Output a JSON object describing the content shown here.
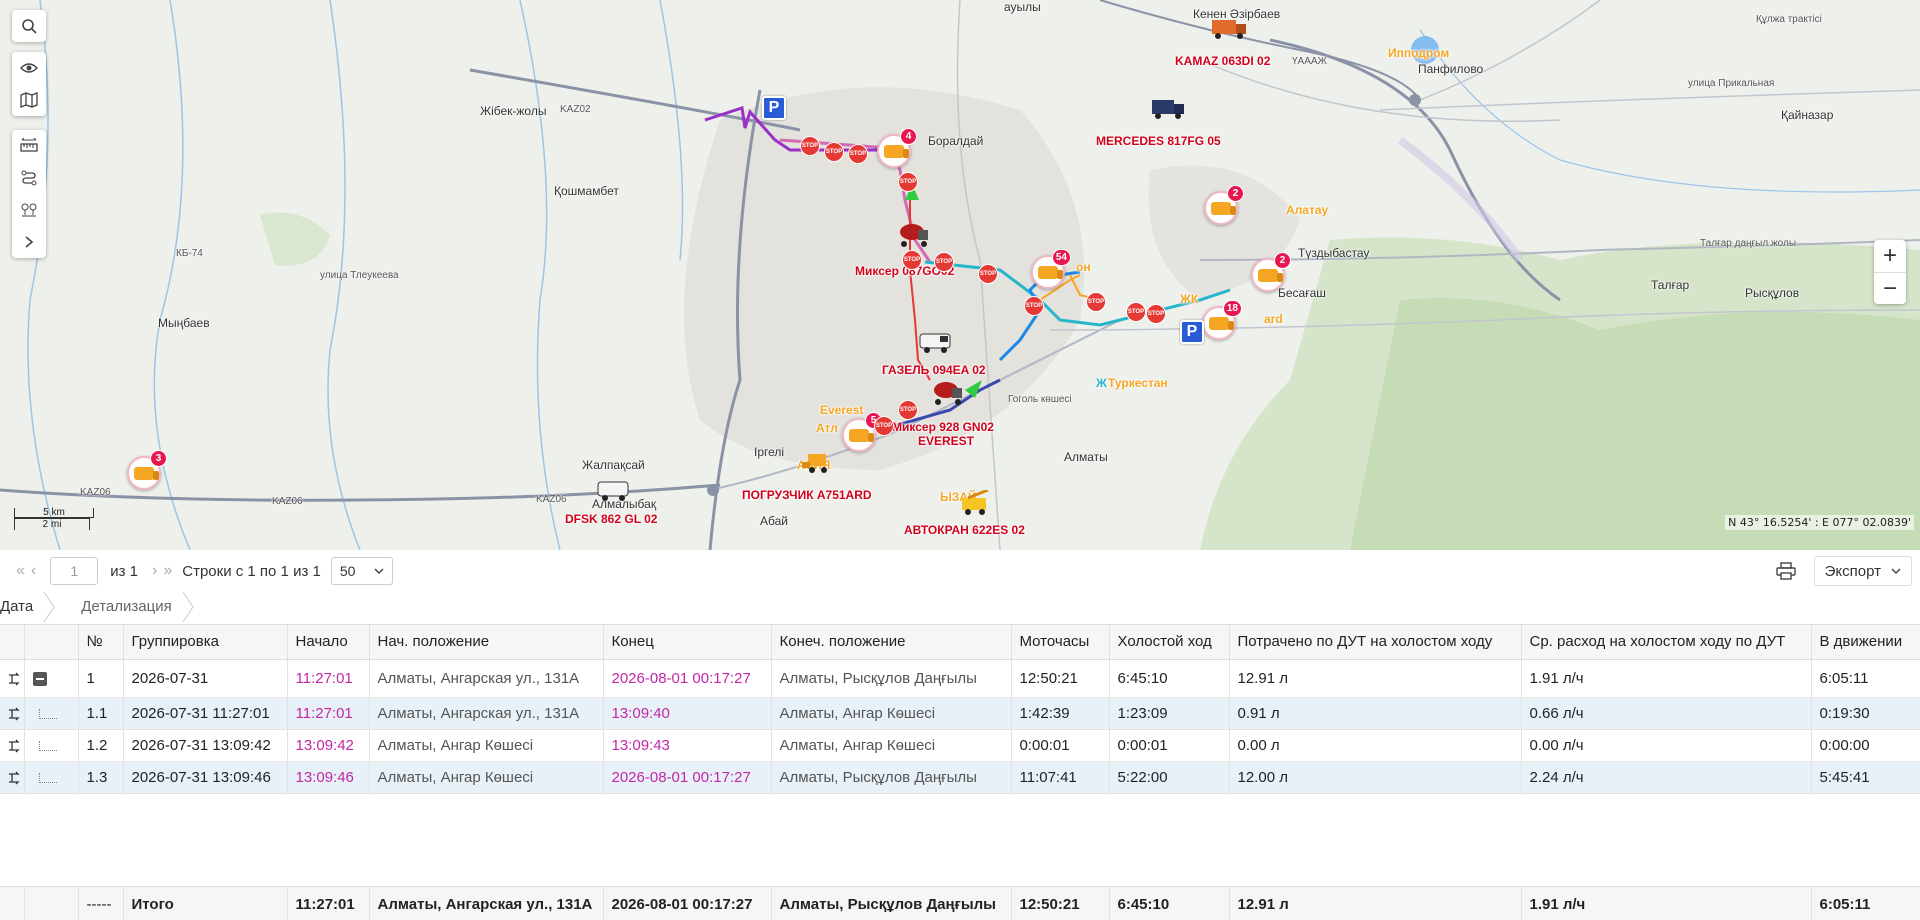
{
  "map": {
    "vehicles": [
      {
        "id": "kamaz",
        "label": "KAMAZ 063DI 02",
        "color": "red"
      },
      {
        "id": "mercedes",
        "label": "MERCEDES 817FG 05",
        "color": "red"
      },
      {
        "id": "mixer087",
        "label": "Миксер 087GO02",
        "color": "red"
      },
      {
        "id": "gazel",
        "label": "ГАЗЕЛЬ 094EA 02",
        "color": "red"
      },
      {
        "id": "mixer928",
        "label": "Миксер 928 GN02",
        "color": "red"
      },
      {
        "id": "everest",
        "label": "EVEREST",
        "color": "red"
      },
      {
        "id": "loader",
        "label": "ПОГРУЗЧИК A751ARD",
        "color": "red"
      },
      {
        "id": "dfsk",
        "label": "DFSK 862 GL 02",
        "color": "red"
      },
      {
        "id": "crane",
        "label": "АВТОКРАН 622ES 02",
        "color": "red"
      }
    ],
    "zone_labels": {
      "alatau": "Алатау",
      "hippodrome": "Ипподром",
      "turkestan": "Туркестан",
      "everest_zone": "Everest",
      "atl": "Атл",
      "asia": "АЗИЯ",
      "bayzak": "ЫЗАЙ",
      "on": "он",
      "zhk": "ЖК",
      "boulevard": "ard",
      "turk_zh": "Ж"
    },
    "places": {
      "aulyl": "ауылы",
      "kenen": "Кенен Әзірбаев",
      "zhibek": "Жібек-жолы",
      "boraldai": "Боралдай",
      "koshmambet": "Қошмамбет",
      "panfilovo": "Панфилово",
      "kainazar": "Қайназар",
      "tuzdybastau": "Түздыбастау",
      "besagash": "Бесағаш",
      "talgar": "Талғар",
      "ryskulov": "Рысқұлов",
      "myngaev": "Мыңбаев",
      "zhalpaksai": "Жалпақсай",
      "almalybak": "Алмалыбақ",
      "irgeli": "Іргелі",
      "abai": "Абай",
      "almaty": "Алматы",
      "goghol": "Гоголь көшесі",
      "tleukeev": "улица Тлеукеева",
      "kaz06a": "KAZ06",
      "kaz06b": "KAZ06",
      "kaz06c": "KAZ06",
      "kaz02": "KAZ02",
      "kb74": "КБ-74",
      "talgar_trakt": "Талғар даңғыл жолы",
      "kulzha_trakt": "Құлжа трактісі",
      "prikal": "улица Прикальная",
      "uaaazh": "ҮАААЖ"
    },
    "badges": {
      "m1": "4",
      "m2": "54",
      "m3": "2",
      "m4": "2",
      "m5": "18",
      "m6": "5",
      "m7": "3"
    },
    "stop_text": "STOP",
    "parking_text": "P",
    "scale_km": "5 km",
    "scale_mi": "2 mi",
    "coords": "N 43° 16.5254' : E 077° 02.0839'",
    "zoom_in": "+",
    "zoom_out": "−"
  },
  "pager": {
    "page": "1",
    "of_pages": "из 1",
    "rows_info": "Строки с 1 по 1 из 1",
    "per_page": "50",
    "export": "Экспорт"
  },
  "breadcrumb": [
    "Дата",
    "Детализация"
  ],
  "table": {
    "columns": [
      "№",
      "Группировка",
      "Начало",
      "Нач. положение",
      "Конец",
      "Конеч. положение",
      "Моточасы",
      "Холостой ход",
      "Потрачено по ДУТ на холостом ходу",
      "Ср. расход на холостом ходу по ДУТ",
      "В движении"
    ],
    "rows": [
      {
        "num": "1",
        "group": "2026-07-31",
        "start": "11:27:01",
        "start_pos": "Алматы, Ангарская ул., 131А",
        "end": "2026-08-01 00:17:27",
        "end_pos": "Алматы, Рысқұлов Даңғылы",
        "moto": "12:50:21",
        "idle": "6:45:10",
        "spent": "12.91 л",
        "avg": "1.91 л/ч",
        "moving": "6:05:11"
      },
      {
        "num": "1.1",
        "group": "2026-07-31 11:27:01",
        "start": "11:27:01",
        "start_pos": "Алматы, Ангарская ул., 131А",
        "end": "13:09:40",
        "end_pos": "Алматы, Ангар Көшесі",
        "moto": "1:42:39",
        "idle": "1:23:09",
        "spent": "0.91 л",
        "avg": "0.66 л/ч",
        "moving": "0:19:30"
      },
      {
        "num": "1.2",
        "group": "2026-07-31 13:09:42",
        "start": "13:09:42",
        "start_pos": "Алматы, Ангар Көшесі",
        "end": "13:09:43",
        "end_pos": "Алматы, Ангар Көшесі",
        "moto": "0:00:01",
        "idle": "0:00:01",
        "spent": "0.00 л",
        "avg": "0.00 л/ч",
        "moving": "0:00:00"
      },
      {
        "num": "1.3",
        "group": "2026-07-31 13:09:46",
        "start": "13:09:46",
        "start_pos": "Алматы, Ангар Көшесі",
        "end": "2026-08-01 00:17:27",
        "end_pos": "Алматы, Рысқұлов Даңғылы",
        "moto": "11:07:41",
        "idle": "5:22:00",
        "spent": "12.00 л",
        "avg": "2.24 л/ч",
        "moving": "5:45:41"
      }
    ],
    "totals": {
      "num": "-----",
      "group": "Итого",
      "start": "11:27:01",
      "start_pos": "Алматы, Ангарская ул., 131А",
      "end": "2026-08-01 00:17:27",
      "end_pos": "Алматы, Рысқұлов Даңғылы",
      "moto": "12:50:21",
      "idle": "6:45:10",
      "spent": "12.91 л",
      "avg": "1.91 л/ч",
      "moving": "6:05:11"
    }
  },
  "colors": {
    "accent_pink": "#c227a6",
    "stop_red": "#e53935",
    "badge": "#e8174f",
    "child_row": "#e8f1f8"
  }
}
